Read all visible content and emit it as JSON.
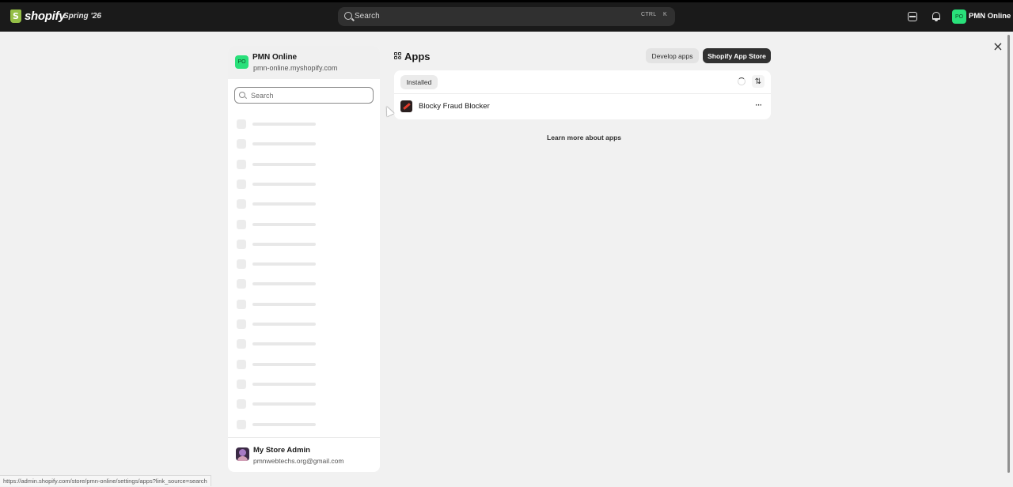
{
  "topbar": {
    "logo_text": "shopify",
    "edition": "Spring '26",
    "search_placeholder": "Search",
    "shortcut_ctrl": "CTRL",
    "shortcut_key": "K",
    "avatar_initials": "PO",
    "store_name": "PMN Online",
    "icons": [
      "shopify-logo-icon",
      "search-icon",
      "store-icon",
      "bell-icon"
    ]
  },
  "modal": {
    "close_label": "×"
  },
  "sidebar": {
    "store_initials": "PO",
    "store_name": "PMN Online",
    "store_domain": "pmn-online.myshopify.com",
    "search_placeholder": "Search",
    "skeleton_row_count": 16,
    "footer": {
      "user_name": "My Store Admin",
      "user_email": "pmnwebtechs.org@gmail.com"
    }
  },
  "main": {
    "title": "Apps",
    "develop_button": "Develop apps",
    "store_button": "Shopify App Store",
    "tab_installed": "Installed",
    "sort_label": "⇅",
    "apps": [
      {
        "name": "Blocky Fraud Blocker",
        "more_label": "···"
      }
    ],
    "learn_more": "Learn more about apps"
  },
  "status_bar": {
    "url": "https://admin.shopify.com/store/pmn-online/settings/apps?link_source=search"
  },
  "colors": {
    "topbar_bg": "#1a1a1a",
    "avatar_green": "#29e07a",
    "primary_button": "#303030",
    "modal_bg": "#f1f1f1"
  }
}
